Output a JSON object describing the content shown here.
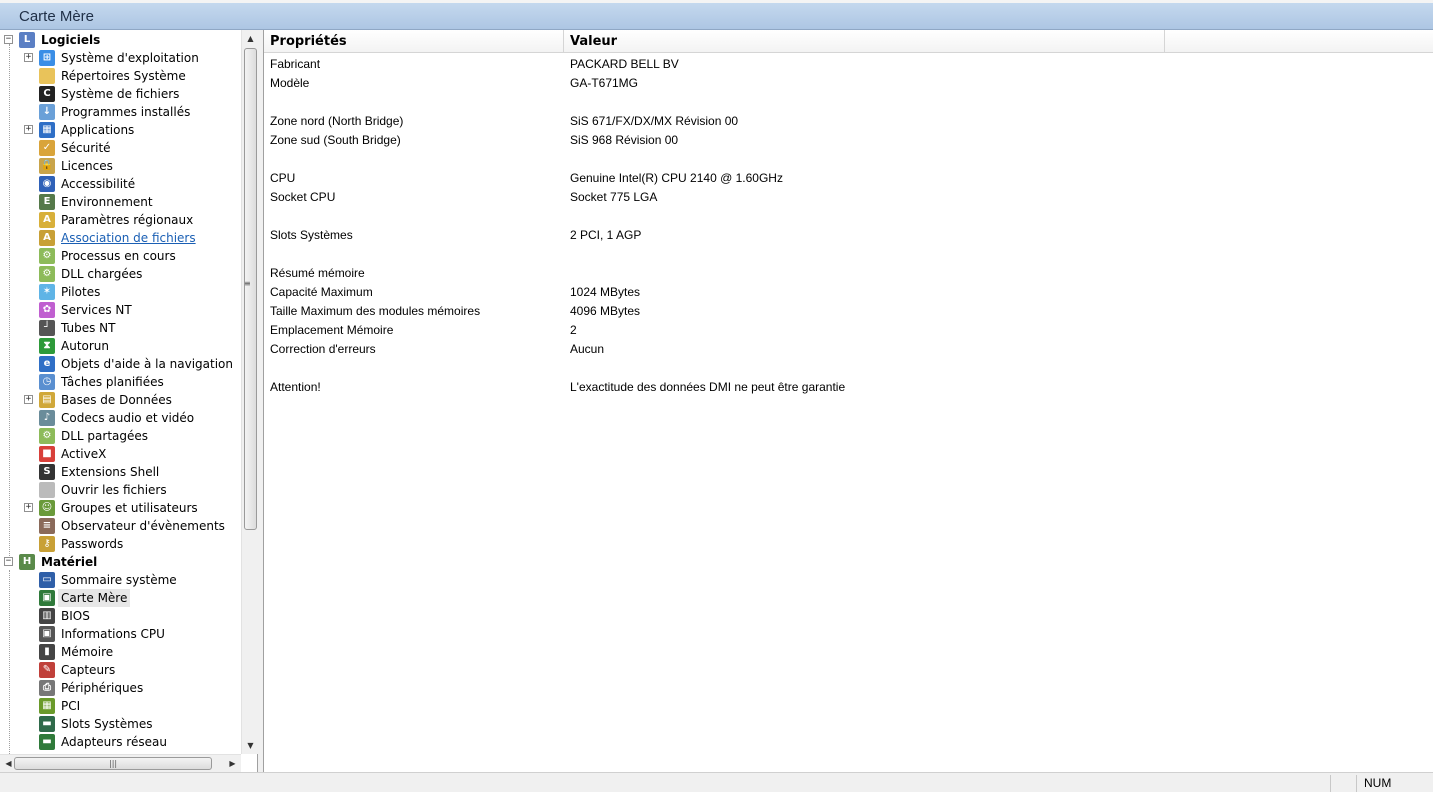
{
  "window": {
    "title": "Carte Mère"
  },
  "tree": {
    "items": [
      {
        "label": "Logiciels",
        "icon": "software-folder-icon",
        "level": 0,
        "group": true,
        "expander": "−",
        "color": "#5b7fc4"
      },
      {
        "label": "Système d'exploitation",
        "icon": "windows-icon",
        "level": 1,
        "expander": "+",
        "color": "#3a8ee6"
      },
      {
        "label": "Répertoires Système",
        "icon": "folder-icon",
        "level": 1,
        "color": "#e9c35a"
      },
      {
        "label": "Système de fichiers",
        "icon": "console-icon",
        "level": 1,
        "color": "#222222"
      },
      {
        "label": "Programmes installés",
        "icon": "install-icon",
        "level": 1,
        "color": "#6aa0d8"
      },
      {
        "label": "Applications",
        "icon": "applications-icon",
        "level": 1,
        "expander": "+",
        "color": "#2f6fc6"
      },
      {
        "label": "Sécurité",
        "icon": "shield-icon",
        "level": 1,
        "color": "#d9a43a"
      },
      {
        "label": "Licences",
        "icon": "lock-icon",
        "level": 1,
        "color": "#c9a44a"
      },
      {
        "label": "Accessibilité",
        "icon": "accessibility-icon",
        "level": 1,
        "color": "#2f61b8"
      },
      {
        "label": "Environnement",
        "icon": "environment-icon",
        "level": 1,
        "color": "#55794a"
      },
      {
        "label": "Paramètres régionaux",
        "icon": "regional-icon",
        "level": 1,
        "color": "#d8b03a"
      },
      {
        "label": "Association de fichiers",
        "icon": "file-association-icon",
        "level": 1,
        "link": true,
        "color": "#c8a036"
      },
      {
        "label": "Processus en cours",
        "icon": "process-icon",
        "level": 1,
        "color": "#8dbb5a"
      },
      {
        "label": "DLL chargées",
        "icon": "dll-icon",
        "level": 1,
        "color": "#8dbb5a"
      },
      {
        "label": "Pilotes",
        "icon": "drivers-icon",
        "level": 1,
        "color": "#5fb4e6"
      },
      {
        "label": "Services NT",
        "icon": "services-icon",
        "level": 1,
        "color": "#c05fd0"
      },
      {
        "label": "Tubes NT",
        "icon": "pipes-icon",
        "level": 1,
        "color": "#555555"
      },
      {
        "label": "Autorun",
        "icon": "autorun-icon",
        "level": 1,
        "color": "#2e9a3a"
      },
      {
        "label": "Objets d'aide à la navigation",
        "icon": "browser-helper-icon",
        "level": 1,
        "color": "#2f6fc6"
      },
      {
        "label": "Tâches planifiées",
        "icon": "scheduled-tasks-icon",
        "level": 1,
        "color": "#5a8fd0"
      },
      {
        "label": "Bases de Données",
        "icon": "database-icon",
        "level": 1,
        "expander": "+",
        "color": "#d0a83a"
      },
      {
        "label": "Codecs audio et vidéo",
        "icon": "codec-icon",
        "level": 1,
        "color": "#6a8c9a"
      },
      {
        "label": "DLL partagées",
        "icon": "shared-dll-icon",
        "level": 1,
        "color": "#8dbb5a"
      },
      {
        "label": "ActiveX",
        "icon": "activex-icon",
        "level": 1,
        "color": "#d8403a"
      },
      {
        "label": "Extensions Shell",
        "icon": "shell-extension-icon",
        "level": 1,
        "color": "#333333"
      },
      {
        "label": "Ouvrir les fichiers",
        "icon": "open-file-icon",
        "level": 1,
        "color": "#bbbbbb"
      },
      {
        "label": "Groupes et utilisateurs",
        "icon": "users-icon",
        "level": 1,
        "expander": "+",
        "color": "#6a9a3a"
      },
      {
        "label": "Observateur d'évènements",
        "icon": "event-viewer-icon",
        "level": 1,
        "color": "#8a6a5a"
      },
      {
        "label": "Passwords",
        "icon": "key-icon",
        "level": 1,
        "color": "#c8a036"
      },
      {
        "label": "Matériel",
        "icon": "hardware-icon",
        "level": 0,
        "group": true,
        "expander": "−",
        "color": "#5a8a4a"
      },
      {
        "label": "Sommaire système",
        "icon": "computer-icon",
        "level": 1,
        "color": "#2f5fa8"
      },
      {
        "label": "Carte Mère",
        "icon": "motherboard-icon",
        "level": 1,
        "selected": true,
        "color": "#2f7a3a"
      },
      {
        "label": "BIOS",
        "icon": "bios-chip-icon",
        "level": 1,
        "color": "#444444"
      },
      {
        "label": "Informations CPU",
        "icon": "cpu-icon",
        "level": 1,
        "color": "#555555"
      },
      {
        "label": "Mémoire",
        "icon": "memory-icon",
        "level": 1,
        "color": "#444444"
      },
      {
        "label": "Capteurs",
        "icon": "sensor-icon",
        "level": 1,
        "color": "#c0403a"
      },
      {
        "label": "Périphériques",
        "icon": "peripherals-icon",
        "level": 1,
        "color": "#777777"
      },
      {
        "label": "PCI",
        "icon": "pci-icon",
        "level": 1,
        "color": "#6a9a2a"
      },
      {
        "label": "Slots Systèmes",
        "icon": "slots-icon",
        "level": 1,
        "color": "#2f6a4a"
      },
      {
        "label": "Adapteurs réseau",
        "icon": "network-adapter-icon",
        "level": 1,
        "color": "#2f7a3a"
      }
    ]
  },
  "table": {
    "headers": {
      "prop": "Propriétés",
      "val": "Valeur"
    },
    "rows": [
      {
        "prop": "Fabricant",
        "val": "PACKARD BELL BV",
        "line": 0
      },
      {
        "prop": "Modèle",
        "val": "GA-T671MG",
        "line": 1
      },
      {
        "prop": "Zone nord (North Bridge)",
        "val": "SiS 671/FX/DX/MX Révision 00",
        "line": 3
      },
      {
        "prop": "Zone sud (South Bridge)",
        "val": "SiS 968 Révision 00",
        "line": 4
      },
      {
        "prop": "CPU",
        "val": "Genuine Intel(R) CPU 2140 @ 1.60GHz",
        "line": 6
      },
      {
        "prop": "Socket CPU",
        "val": "Socket 775 LGA",
        "line": 7
      },
      {
        "prop": "Slots Systèmes",
        "val": "2 PCI, 1 AGP",
        "line": 9
      },
      {
        "prop": "Résumé mémoire",
        "val": "",
        "line": 11
      },
      {
        "prop": "Capacité Maximum",
        "val": "1024 MBytes",
        "line": 12
      },
      {
        "prop": "Taille Maximum des modules mémoires",
        "val": "4096 MBytes",
        "line": 13
      },
      {
        "prop": "Emplacement Mémoire",
        "val": "2",
        "line": 14
      },
      {
        "prop": "Correction d'erreurs",
        "val": "Aucun",
        "line": 15
      },
      {
        "prop": "Attention!",
        "val": "L'exactitude des données DMI ne peut être garantie",
        "line": 17
      }
    ]
  },
  "statusbar": {
    "num": "NUM"
  }
}
